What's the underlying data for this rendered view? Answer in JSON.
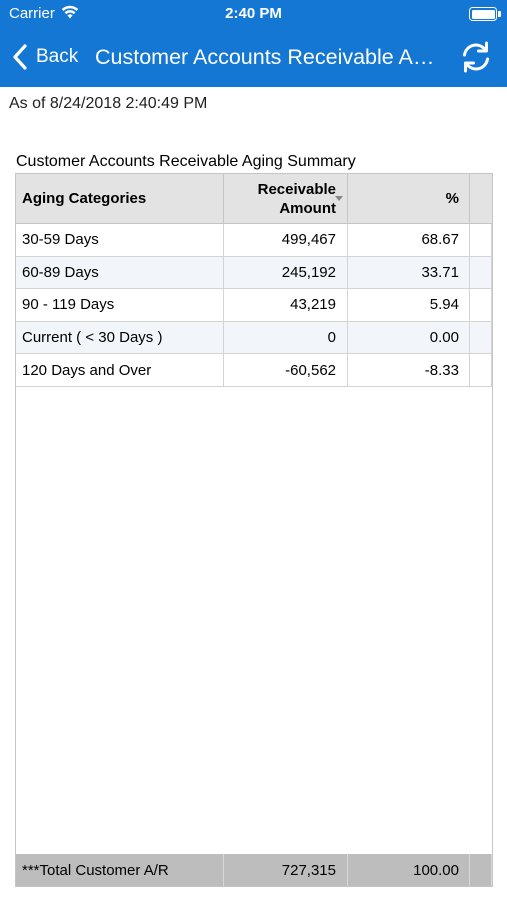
{
  "status_bar": {
    "carrier": "Carrier",
    "time": "2:40 PM"
  },
  "nav": {
    "back_label": "Back",
    "title": "Customer Accounts Receivable Aging Summary"
  },
  "as_of": "As of 8/24/2018 2:40:49 PM",
  "table": {
    "caption": "Customer Accounts Receivable Aging Summary",
    "headers": {
      "category": "Aging Categories",
      "amount_line1": "Receivable",
      "amount_line2": "Amount",
      "percent": "%"
    },
    "rows": [
      {
        "category": "30-59 Days",
        "amount": "499,467",
        "percent": "68.67"
      },
      {
        "category": "60-89 Days",
        "amount": "245,192",
        "percent": "33.71"
      },
      {
        "category": "90 - 119 Days",
        "amount": "43,219",
        "percent": "5.94"
      },
      {
        "category": "Current ( < 30 Days )",
        "amount": "0",
        "percent": "0.00"
      },
      {
        "category": "120 Days and Over",
        "amount": "-60,562",
        "percent": "-8.33"
      }
    ],
    "footer": {
      "label": "***Total Customer A/R",
      "amount": "727,315",
      "percent": "100.00"
    }
  },
  "colors": {
    "nav_background": "#1477d4",
    "header_background": "#e3e3e3",
    "footer_background": "#bdbdbd",
    "alt_row_background": "#f2f6fa"
  },
  "icons": {
    "back": "chevron-left-icon",
    "refresh": "refresh-icon",
    "wifi": "wifi-icon",
    "battery": "battery-icon"
  }
}
